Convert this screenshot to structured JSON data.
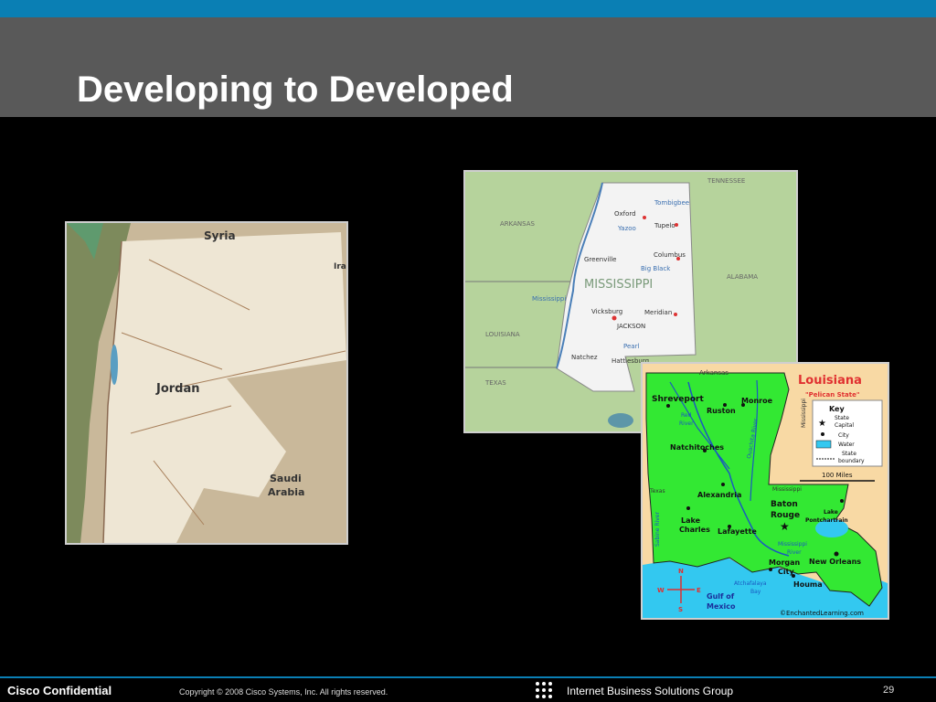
{
  "slide": {
    "title": "Developing to Developed"
  },
  "maps": {
    "jordan": {
      "labels": {
        "syria": "Syria",
        "jordan": "Jordan",
        "saudi1": "Saudi",
        "saudi2": "Arabia",
        "iraq": "Ira"
      }
    },
    "mississippi": {
      "labels": {
        "tennessee": "TENNESSEE",
        "arkansas": "ARKANSAS",
        "alabama": "ALABAMA",
        "louisiana": "LOUISIANA",
        "texas": "TEXAS",
        "state": "MISSISSIPPI",
        "oxford": "Oxford",
        "tombigbee": "Tombigbee",
        "tupelo": "Tupelo",
        "yazoo": "Yazoo",
        "greenville": "Greenville",
        "columbus": "Columbus",
        "bigblack": "Big Black",
        "mississippi_river": "Mississippi",
        "vicksburg": "Vicksburg",
        "jackson": "JACKSON",
        "meridian": "Meridian",
        "pearl": "Pearl",
        "natchez": "Natchez",
        "hattiesburg": "Hattiesburg"
      }
    },
    "louisiana": {
      "labels": {
        "title": "Louisiana",
        "nickname": "\"Pelican State\"",
        "arkansas": "Arkansas",
        "mississippi_side": "Mississippi",
        "shreveport": "Shreveport",
        "ruston": "Ruston",
        "monroe": "Monroe",
        "red_river1": "Red",
        "red_river2": "River",
        "ouachita": "Ouachita River",
        "natchitoches": "Natchitoches",
        "alexandria": "Alexandria",
        "texas": "Texas",
        "sabine": "Sabine River",
        "lake_charles1": "Lake",
        "lake_charles2": "Charles",
        "lafayette": "Lafayette",
        "baton_rouge1": "Baton",
        "baton_rouge2": "Rouge",
        "lake_pont1": "Lake",
        "lake_pont2": "Pontchartrain",
        "ms_river1": "Mississippi",
        "ms_river2": "River",
        "new_orleans": "New Orleans",
        "morgan1": "Morgan",
        "morgan2": "City",
        "houma": "Houma",
        "atchafalaya1": "Atchafalaya",
        "atchafalaya2": "Bay",
        "gulf1": "Gulf of",
        "gulf2": "Mexico",
        "credit": "©EnchantedLearning.com",
        "mississippi_state": "Mississippi",
        "key_title": "Key",
        "key_capital1": "State",
        "key_capital2": "Capital",
        "key_city": "City",
        "key_water": "Water",
        "key_boundary1": "State",
        "key_boundary2": "boundary",
        "scale": "100 Miles",
        "compass_n": "N",
        "compass_s": "S",
        "compass_e": "E",
        "compass_w": "W"
      }
    }
  },
  "footer": {
    "confidential": "Cisco Confidential",
    "copyright": "Copyright © 2008 Cisco Systems, Inc. All rights reserved.",
    "group": "Internet Business Solutions Group",
    "page_number": "29"
  },
  "colors": {
    "accent": "#0a7fb4",
    "title_bar": "#595959",
    "background": "#000000",
    "louisiana_land": "#33e833",
    "water": "#33c8f0"
  }
}
